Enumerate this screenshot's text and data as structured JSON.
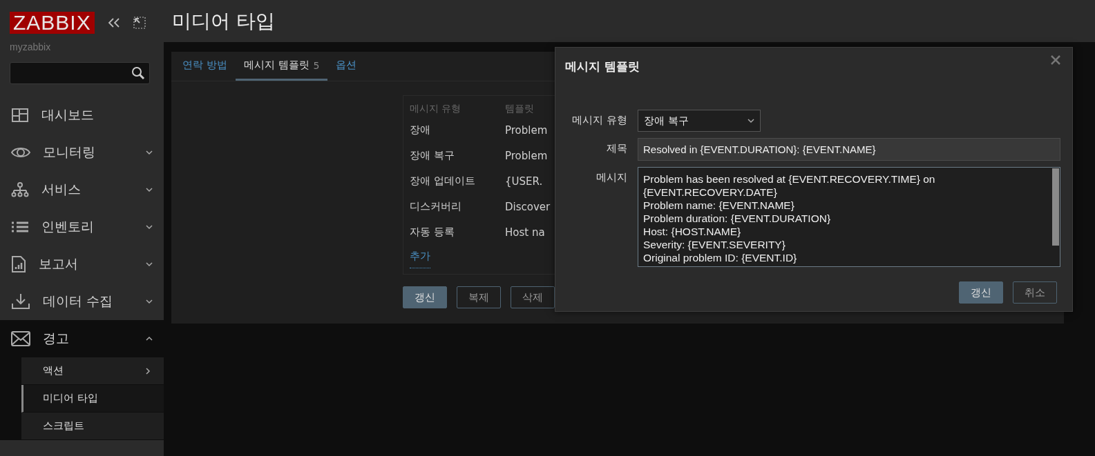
{
  "sidebar": {
    "logo": "ZABBIX",
    "server": "myzabbix",
    "items": [
      {
        "label": "대시보드",
        "expandable": false,
        "expanded": false
      },
      {
        "label": "모니터링",
        "expandable": true,
        "expanded": false
      },
      {
        "label": "서비스",
        "expandable": true,
        "expanded": false
      },
      {
        "label": "인벤토리",
        "expandable": true,
        "expanded": false
      },
      {
        "label": "보고서",
        "expandable": true,
        "expanded": false
      },
      {
        "label": "데이터 수집",
        "expandable": true,
        "expanded": false
      },
      {
        "label": "경고",
        "expandable": true,
        "expanded": true,
        "children": [
          {
            "label": "액션",
            "selected": false,
            "submenu": true
          },
          {
            "label": "미디어 타입",
            "selected": true,
            "submenu": false
          },
          {
            "label": "스크립트",
            "selected": false,
            "submenu": false
          }
        ]
      }
    ]
  },
  "page_title": "미디어 타입",
  "tabs": [
    {
      "label": "연락 방법",
      "selected": false
    },
    {
      "label": "메시지 템플릿",
      "count": "5",
      "selected": true
    },
    {
      "label": "옵션",
      "selected": false
    }
  ],
  "templates_table": {
    "columns": [
      "메시지 유형",
      "템플릿"
    ],
    "rows": [
      [
        "장애",
        "Problem"
      ],
      [
        "장애 복구",
        "Problem"
      ],
      [
        "장애 업데이트",
        "{USER."
      ],
      [
        "디스커버리",
        "Discover"
      ],
      [
        "자동 등록",
        "Host na"
      ]
    ],
    "add_link": "추가"
  },
  "form_buttons": [
    {
      "label": "갱신",
      "primary": true
    },
    {
      "label": "복제",
      "primary": false
    },
    {
      "label": "삭제",
      "primary": false
    }
  ],
  "dialog": {
    "title": "메시지 템플릿",
    "fields": [
      {
        "kind": "select",
        "label": "메시지 유형",
        "value": "장애 복구"
      },
      {
        "kind": "text",
        "label": "제목",
        "value": "Resolved in {EVENT.DURATION}: {EVENT.NAME}"
      },
      {
        "kind": "textarea",
        "label": "메시지",
        "value": "Problem has been resolved at {EVENT.RECOVERY.TIME} on {EVENT.RECOVERY.DATE}\nProblem name: {EVENT.NAME}\nProblem duration: {EVENT.DURATION}\nHost: {HOST.NAME}\nSeverity: {EVENT.SEVERITY}\nOriginal problem ID: {EVENT.ID}"
      }
    ],
    "buttons": [
      {
        "label": "갱신",
        "primary": true
      },
      {
        "label": "취소",
        "primary": false
      }
    ]
  }
}
